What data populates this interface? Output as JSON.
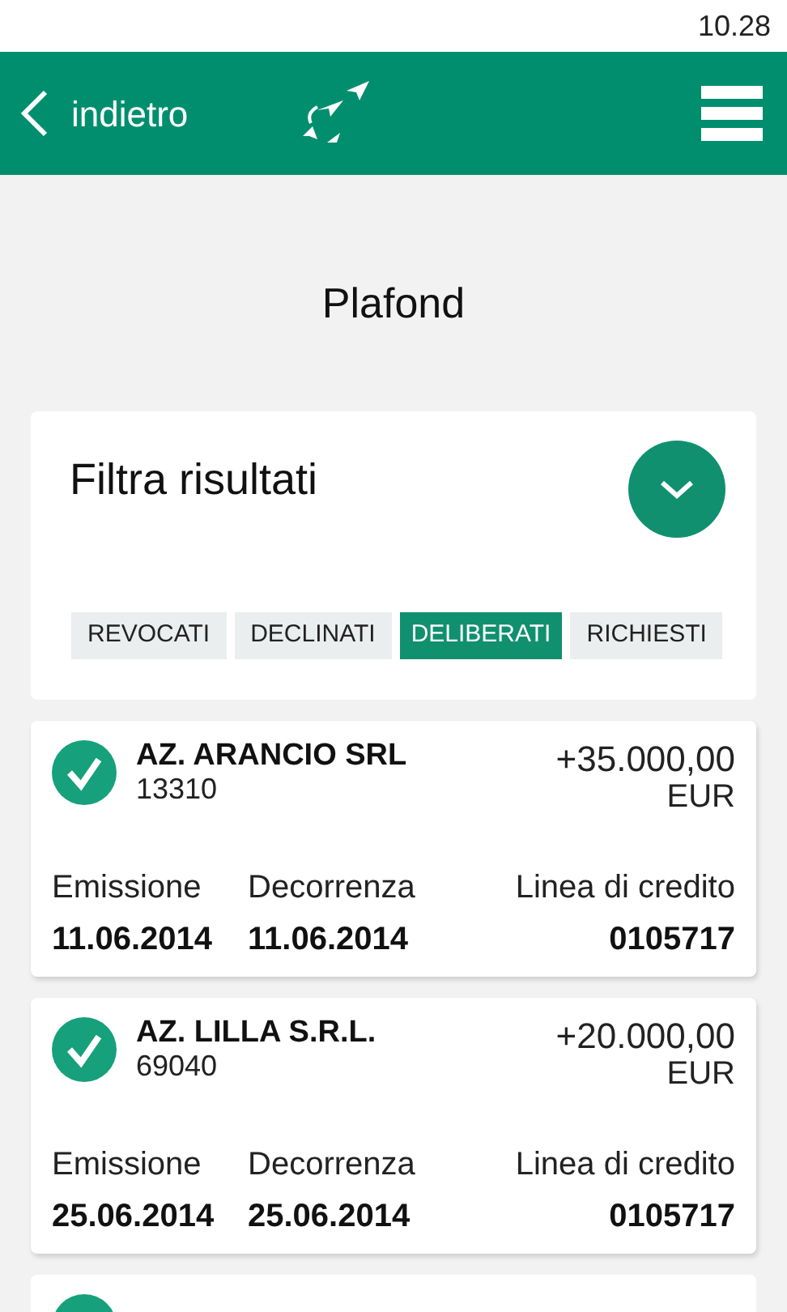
{
  "status_bar": {
    "time": "10.28"
  },
  "header": {
    "back_label": "indietro"
  },
  "page_title": "Plafond",
  "filter": {
    "title": "Filtra risultati",
    "expanded": false,
    "tabs": [
      {
        "label": "REVOCATI",
        "selected": false
      },
      {
        "label": "DECLINATI",
        "selected": false
      },
      {
        "label": "DELIBERATI",
        "selected": true
      },
      {
        "label": "RICHIESTI",
        "selected": false
      }
    ]
  },
  "records": [
    {
      "name": "AZ. ARANCIO SRL",
      "code": "13310",
      "amount": "+35.000,00",
      "currency": "EUR",
      "labels": [
        "Emissione",
        "Decorrenza",
        "Linea di credito"
      ],
      "values": [
        "11.06.2014",
        "11.06.2014",
        "0105717"
      ]
    },
    {
      "name": "AZ. LILLA S.R.L.",
      "code": "69040",
      "amount": "+20.000,00",
      "currency": "EUR",
      "labels": [
        "Emissione",
        "Decorrenza",
        "Linea di credito"
      ],
      "values": [
        "25.06.2014",
        "25.06.2014",
        "0105717"
      ]
    }
  ]
}
